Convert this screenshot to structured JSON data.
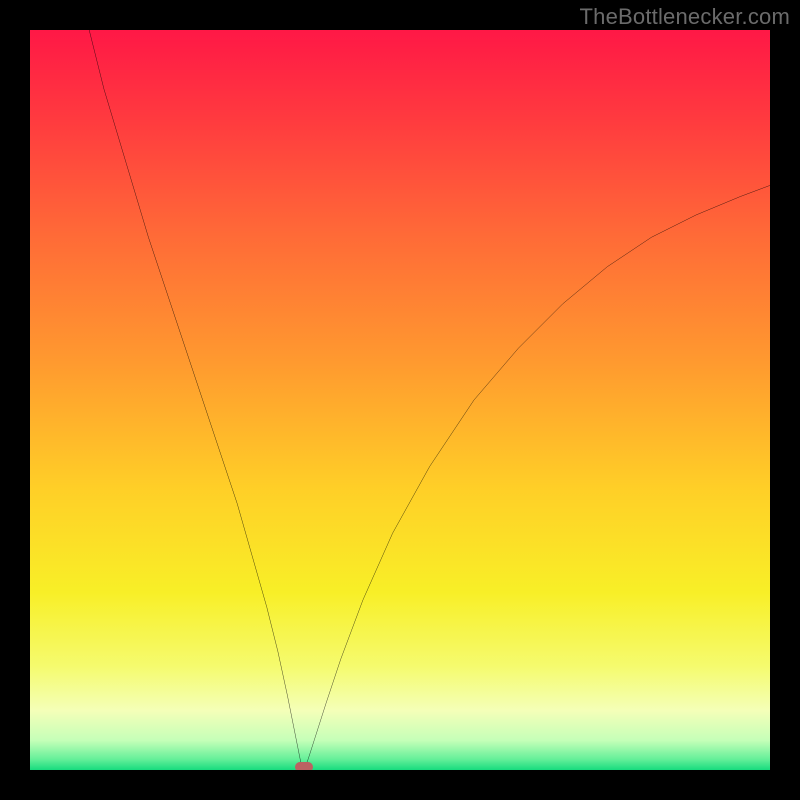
{
  "watermark": {
    "text": "TheBottlenecker.com"
  },
  "chart_data": {
    "type": "line",
    "title": "",
    "xlabel": "",
    "ylabel": "",
    "xlim": [
      0,
      100
    ],
    "ylim": [
      0,
      100
    ],
    "legend": false,
    "grid": false,
    "background_gradient": {
      "stops": [
        {
          "pos": 0.0,
          "color": "#ff1846"
        },
        {
          "pos": 0.12,
          "color": "#ff3a3f"
        },
        {
          "pos": 0.28,
          "color": "#ff6b37"
        },
        {
          "pos": 0.45,
          "color": "#ff9a2f"
        },
        {
          "pos": 0.62,
          "color": "#ffcf27"
        },
        {
          "pos": 0.76,
          "color": "#f8ef27"
        },
        {
          "pos": 0.86,
          "color": "#f5fb6e"
        },
        {
          "pos": 0.92,
          "color": "#f4ffb8"
        },
        {
          "pos": 0.96,
          "color": "#c5ffb8"
        },
        {
          "pos": 0.985,
          "color": "#67f09a"
        },
        {
          "pos": 1.0,
          "color": "#17db7e"
        }
      ]
    },
    "series": [
      {
        "name": "left-branch",
        "x": [
          8,
          10,
          13,
          16,
          19,
          22,
          25,
          28,
          30,
          32,
          33.5,
          34.8,
          35.6,
          36.2,
          36.6,
          36.9
        ],
        "y": [
          100,
          92,
          82,
          72,
          63,
          54,
          45,
          36,
          29,
          22,
          16,
          10,
          6,
          3,
          1,
          0.2
        ]
      },
      {
        "name": "right-branch",
        "x": [
          37.1,
          37.6,
          38.4,
          40,
          42,
          45,
          49,
          54,
          60,
          66,
          72,
          78,
          84,
          90,
          96,
          100
        ],
        "y": [
          0.2,
          1.5,
          4,
          9,
          15,
          23,
          32,
          41,
          50,
          57,
          63,
          68,
          72,
          75,
          77.5,
          79
        ]
      }
    ],
    "marker": {
      "x": 37,
      "y": 0.4,
      "label": "bottleneck-indicator"
    }
  }
}
